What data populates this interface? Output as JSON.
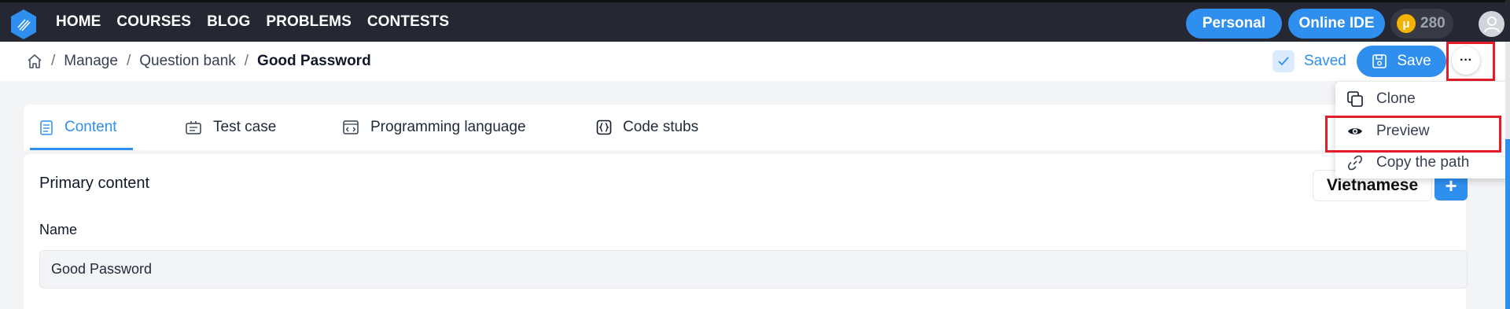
{
  "nav": {
    "items": [
      "HOME",
      "COURSES",
      "BLOG",
      "PROBLEMS",
      "CONTESTS"
    ],
    "personal_label": "Personal",
    "online_ide_label": "Online IDE",
    "coin_symbol": "μ",
    "coin_count": "280"
  },
  "breadcrumb": {
    "sep": "/",
    "items": [
      "Manage",
      "Question bank",
      "Good Password"
    ]
  },
  "toolbar": {
    "saved_label": "Saved",
    "save_label": "Save",
    "more_label": "···"
  },
  "tabs": [
    {
      "label": "Content",
      "active": true
    },
    {
      "label": "Test case",
      "active": false
    },
    {
      "label": "Programming language",
      "active": false
    },
    {
      "label": "Code stubs",
      "active": false
    }
  ],
  "content": {
    "section_title": "Primary content",
    "language": "Vietnamese",
    "add_label": "+",
    "name_label": "Name",
    "name_value": "Good Password"
  },
  "dropdown": {
    "items": [
      {
        "label": "Clone",
        "icon": "clone-icon"
      },
      {
        "label": "Preview",
        "icon": "eye-icon"
      },
      {
        "label": "Copy the path",
        "icon": "link-icon"
      }
    ]
  },
  "colors": {
    "primary": "#2f8fef",
    "navbar": "#252833",
    "highlight": "#e11d2a",
    "coin": "#f5b301"
  }
}
